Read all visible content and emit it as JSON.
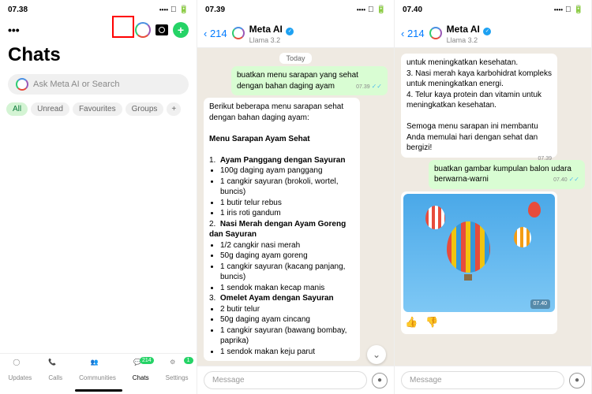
{
  "pane1": {
    "time": "07.38",
    "title": "Chats",
    "search_placeholder": "Ask Meta AI or Search",
    "pills": [
      "All",
      "Unread",
      "Favourites",
      "Groups"
    ],
    "tabs": [
      {
        "label": "Updates"
      },
      {
        "label": "Calls"
      },
      {
        "label": "Communities"
      },
      {
        "label": "Chats",
        "badge": "214",
        "active": true
      },
      {
        "label": "Settings",
        "badge": "1"
      }
    ]
  },
  "pane2": {
    "time": "07.39",
    "back": "214",
    "name": "Meta AI",
    "sub": "Llama 3.2",
    "day": "Today",
    "user_msg": "buatkan menu sarapan yang sehat dengan bahan daging ayam",
    "user_time": "07.39",
    "ai_intro": "Berikut beberapa menu sarapan sehat dengan bahan daging ayam:",
    "ai_heading": "Menu Sarapan Ayam Sehat",
    "m1_title": "Ayam Panggang dengan Sayuran",
    "m1_items": [
      "100g daging ayam panggang",
      "1 cangkir sayuran (brokoli, wortel, buncis)",
      "1 butir telur rebus",
      "1 iris roti gandum"
    ],
    "m2_title": "Nasi Merah dengan Ayam Goreng dan Sayuran",
    "m2_items": [
      "1/2 cangkir nasi merah",
      "50g daging ayam goreng",
      "1 cangkir sayuran (kacang panjang, buncis)",
      "1 sendok makan kecap manis"
    ],
    "m3_title": "Omelet Ayam dengan Sayuran",
    "m3_items": [
      "2 butir telur",
      "50g daging ayam cincang",
      "1 cangkir sayuran (bawang bombay, paprika)",
      "1 sendok makan keju parut"
    ],
    "input_placeholder": "Message"
  },
  "pane3": {
    "time": "07.40",
    "back": "214",
    "name": "Meta AI",
    "sub": "Llama 3.2",
    "ai_lines": [
      "untuk meningkatkan kesehatan.",
      "3.  Nasi merah kaya karbohidrat kompleks untuk meningkatkan energi.",
      "4.  Telur kaya protein dan vitamin untuk meningkatkan kesehatan.",
      "",
      "Semoga menu sarapan ini membantu Anda memulai hari dengan sehat dan bergizi!"
    ],
    "ai_time": "07.39",
    "user_msg": "buatkan gambar kumpulan balon udara berwarna-warni",
    "user_time": "07.40",
    "img_time": "07.40",
    "input_placeholder": "Message"
  }
}
